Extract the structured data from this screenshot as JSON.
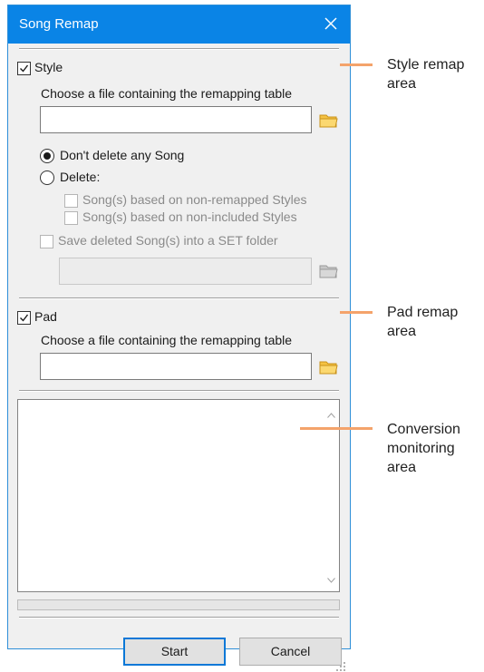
{
  "window": {
    "title": "Song Remap"
  },
  "style_section": {
    "checkbox_label": "Style",
    "checked": true,
    "file_prompt": "Choose a file containing the remapping table",
    "file_value": "",
    "radio_keep_label": "Don't delete any Song",
    "radio_delete_label": "Delete:",
    "selected_option": "Don't delete any Song",
    "delete_option_nonremapped": "Song(s) based on non-remapped Styles",
    "delete_option_nonincluded": "Song(s) based on non-included Styles",
    "save_deleted_label": "Save deleted Song(s) into a SET folder",
    "set_folder_value": ""
  },
  "pad_section": {
    "checkbox_label": "Pad",
    "checked": true,
    "file_prompt": "Choose a file containing the remapping table",
    "file_value": ""
  },
  "monitor": {
    "content": ""
  },
  "buttons": {
    "start": "Start",
    "cancel": "Cancel"
  },
  "callouts": {
    "style": [
      "Style remap",
      "area"
    ],
    "pad": [
      "Pad remap",
      "area"
    ],
    "monitor": [
      "Conversion",
      "monitoring",
      "area"
    ]
  },
  "colors": {
    "title_bar": "#0a84e6",
    "dialog_bg": "#f0f0f0",
    "callout_line": "#f4a36b",
    "folder_icon": "#f5c242",
    "default_button_border": "#0a78d7"
  },
  "icons": [
    "close-icon",
    "folder-icon",
    "checkmark-icon",
    "scroll-up-icon",
    "scroll-down-icon",
    "resize-grip-icon"
  ]
}
